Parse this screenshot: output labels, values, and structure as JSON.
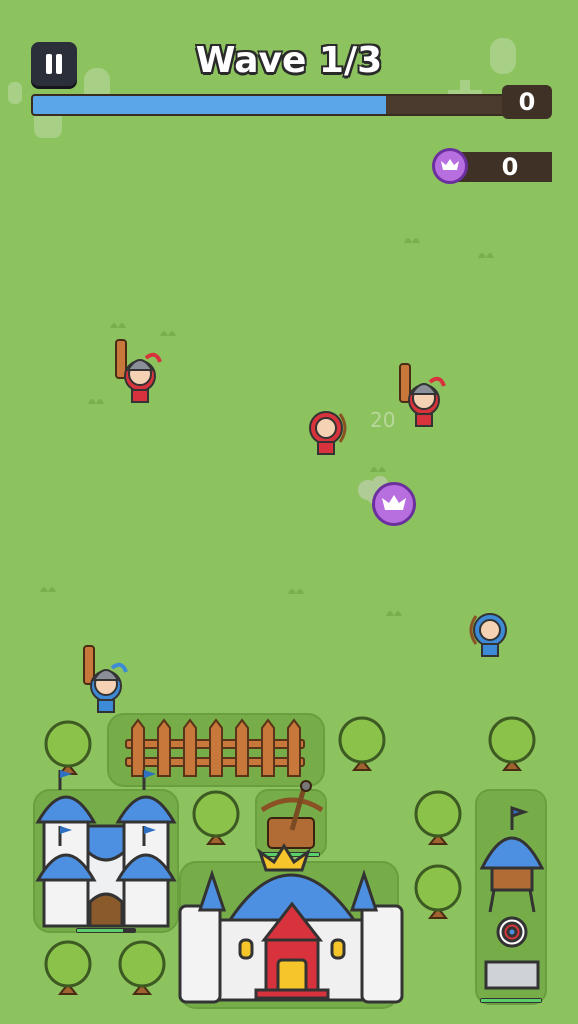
{
  "hud": {
    "wave_title": "Wave 1/3",
    "wave_progress": 0.72,
    "score": "0",
    "gems": "0"
  },
  "field": {
    "damage_text": "20"
  },
  "colors": {
    "grass": "#8cc35e",
    "red_team": "#d8323c",
    "blue_team": "#3d8ad6",
    "gem": "#b76fe0"
  },
  "icons": [
    "pause-icon",
    "crown-gem-icon"
  ]
}
